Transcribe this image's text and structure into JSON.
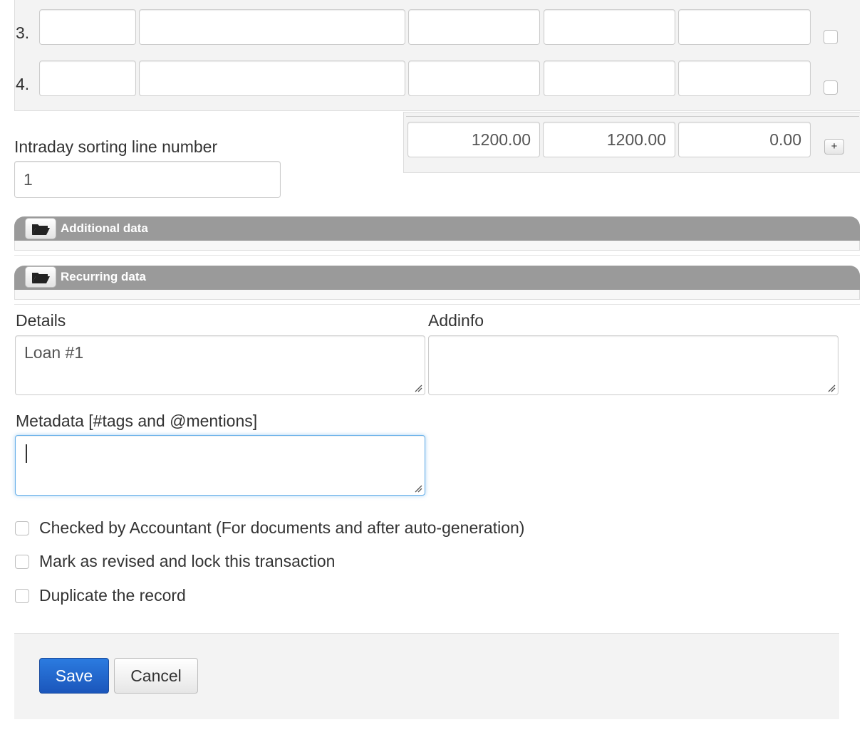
{
  "lines": [
    {
      "number": "3."
    },
    {
      "number": "4."
    }
  ],
  "totals": {
    "debit": "1200.00",
    "credit": "1200.00",
    "difference": "0.00",
    "add_button": "+"
  },
  "sorting": {
    "label": "Intraday sorting line number",
    "value": "1"
  },
  "sections": {
    "additional": "Additional data",
    "recurring": "Recurring data"
  },
  "details": {
    "label": "Details",
    "value": "Loan #1"
  },
  "addinfo": {
    "label": "Addinfo",
    "value": ""
  },
  "metadata": {
    "label": "Metadata [#tags and @mentions]",
    "value": ""
  },
  "checkboxes": {
    "checked_by_accountant": "Checked by Accountant (For documents and after auto-generation)",
    "mark_revised": "Mark as revised and lock this transaction",
    "duplicate": "Duplicate the record"
  },
  "actions": {
    "save": "Save",
    "cancel": "Cancel"
  },
  "colors": {
    "primary": "#1f62c9",
    "section_bar": "#9a9a9a",
    "panel_bg": "#f3f3f3",
    "focus_border": "#66afe9"
  }
}
